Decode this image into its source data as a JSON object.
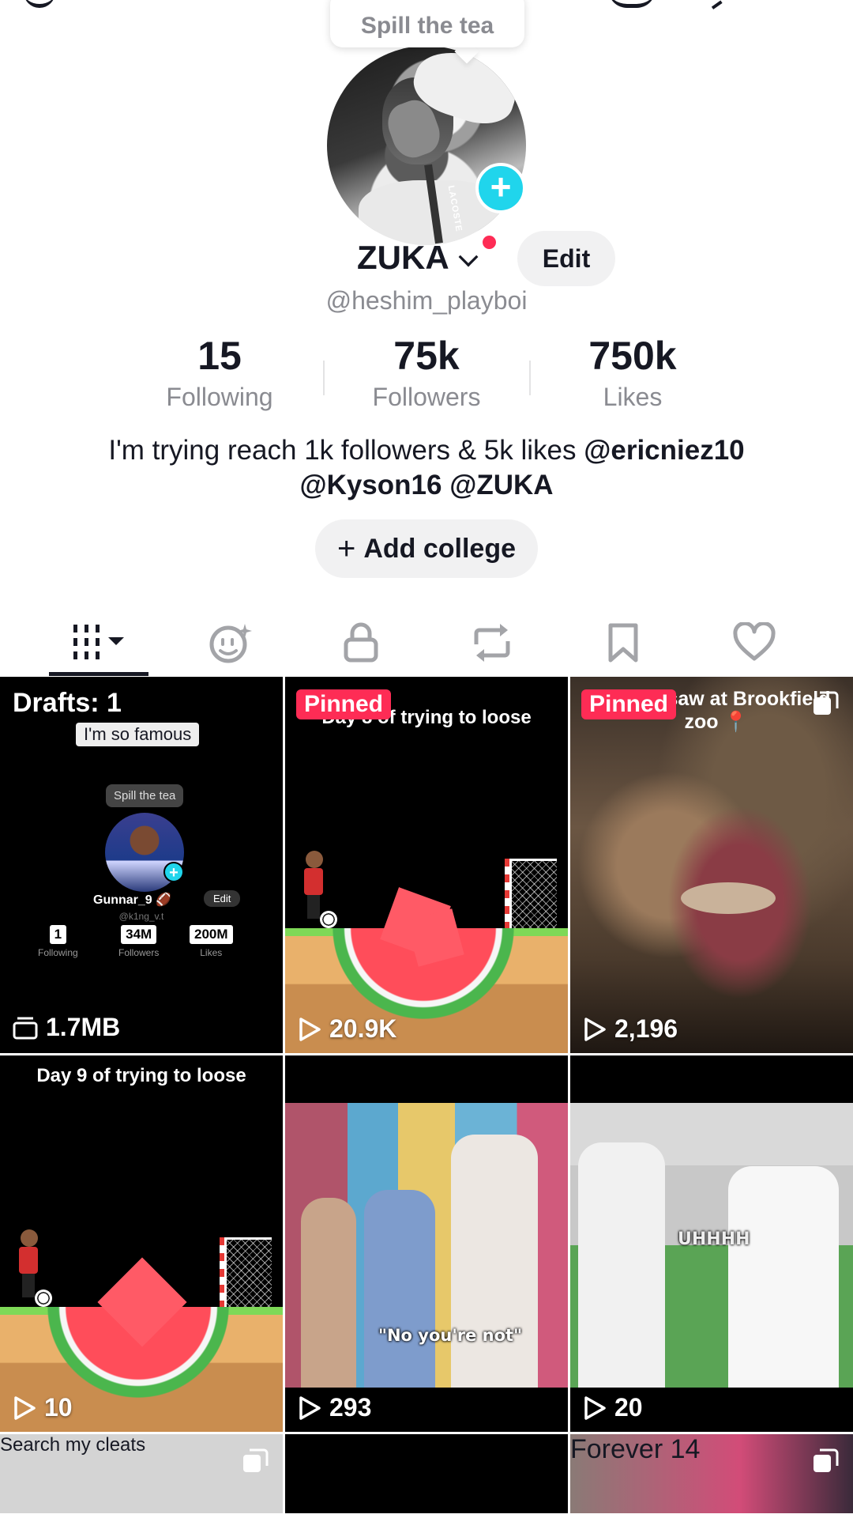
{
  "profile": {
    "bubble_text": "Spill the tea",
    "display_name": "ZUKA",
    "edit_label": "Edit",
    "handle": "@heshim_playboi",
    "bio_plain": "I'm trying reach 1k followers & 5k likes ",
    "bio_mention_1": "@ericniez10",
    "bio_mention_2": "@Kyson16",
    "bio_mention_3": "@ZUKA",
    "add_college_label": "Add college",
    "stats": [
      {
        "value": "15",
        "label": "Following"
      },
      {
        "value": "75k",
        "label": "Followers"
      },
      {
        "value": "750k",
        "label": "Likes"
      }
    ]
  },
  "tabs": [
    "videos-grid",
    "ai-self",
    "private",
    "reposts",
    "favorites",
    "liked"
  ],
  "grid": {
    "drafts": {
      "title": "Drafts: 1",
      "overlay_text": "I'm so famous",
      "size": "1.7MB",
      "mini_profile": {
        "bubble": "Spill the tea",
        "name": "Gunnar_9 🏈",
        "edit": "Edit",
        "handle": "@k1ng_v.t",
        "stats": [
          {
            "value": "1",
            "label": "Following"
          },
          {
            "value": "34M",
            "label": "Followers"
          },
          {
            "value": "200M",
            "label": "Likes"
          }
        ]
      }
    },
    "videos": [
      {
        "pinned": "Pinned",
        "caption": "Day 8 of trying to loose",
        "views": "20.9K"
      },
      {
        "pinned": "Pinned",
        "caption": "What I saw at Brookfield zoo 📍",
        "views": "2,196"
      },
      {
        "caption": "Day 9 of trying to loose",
        "views": "10"
      },
      {
        "subtitle": "\"No you're not\"",
        "views": "293"
      },
      {
        "subtitle": "UHHHH",
        "views": "20"
      }
    ],
    "bottom_row": [
      {
        "caption": "Search my cleats"
      },
      {
        "caption": ""
      },
      {
        "caption": "Forever 14"
      }
    ]
  },
  "colors": {
    "accent_red": "#fe2c55",
    "accent_cyan": "#20d5ec",
    "text_primary": "#161823",
    "text_secondary": "#8a8b91"
  }
}
